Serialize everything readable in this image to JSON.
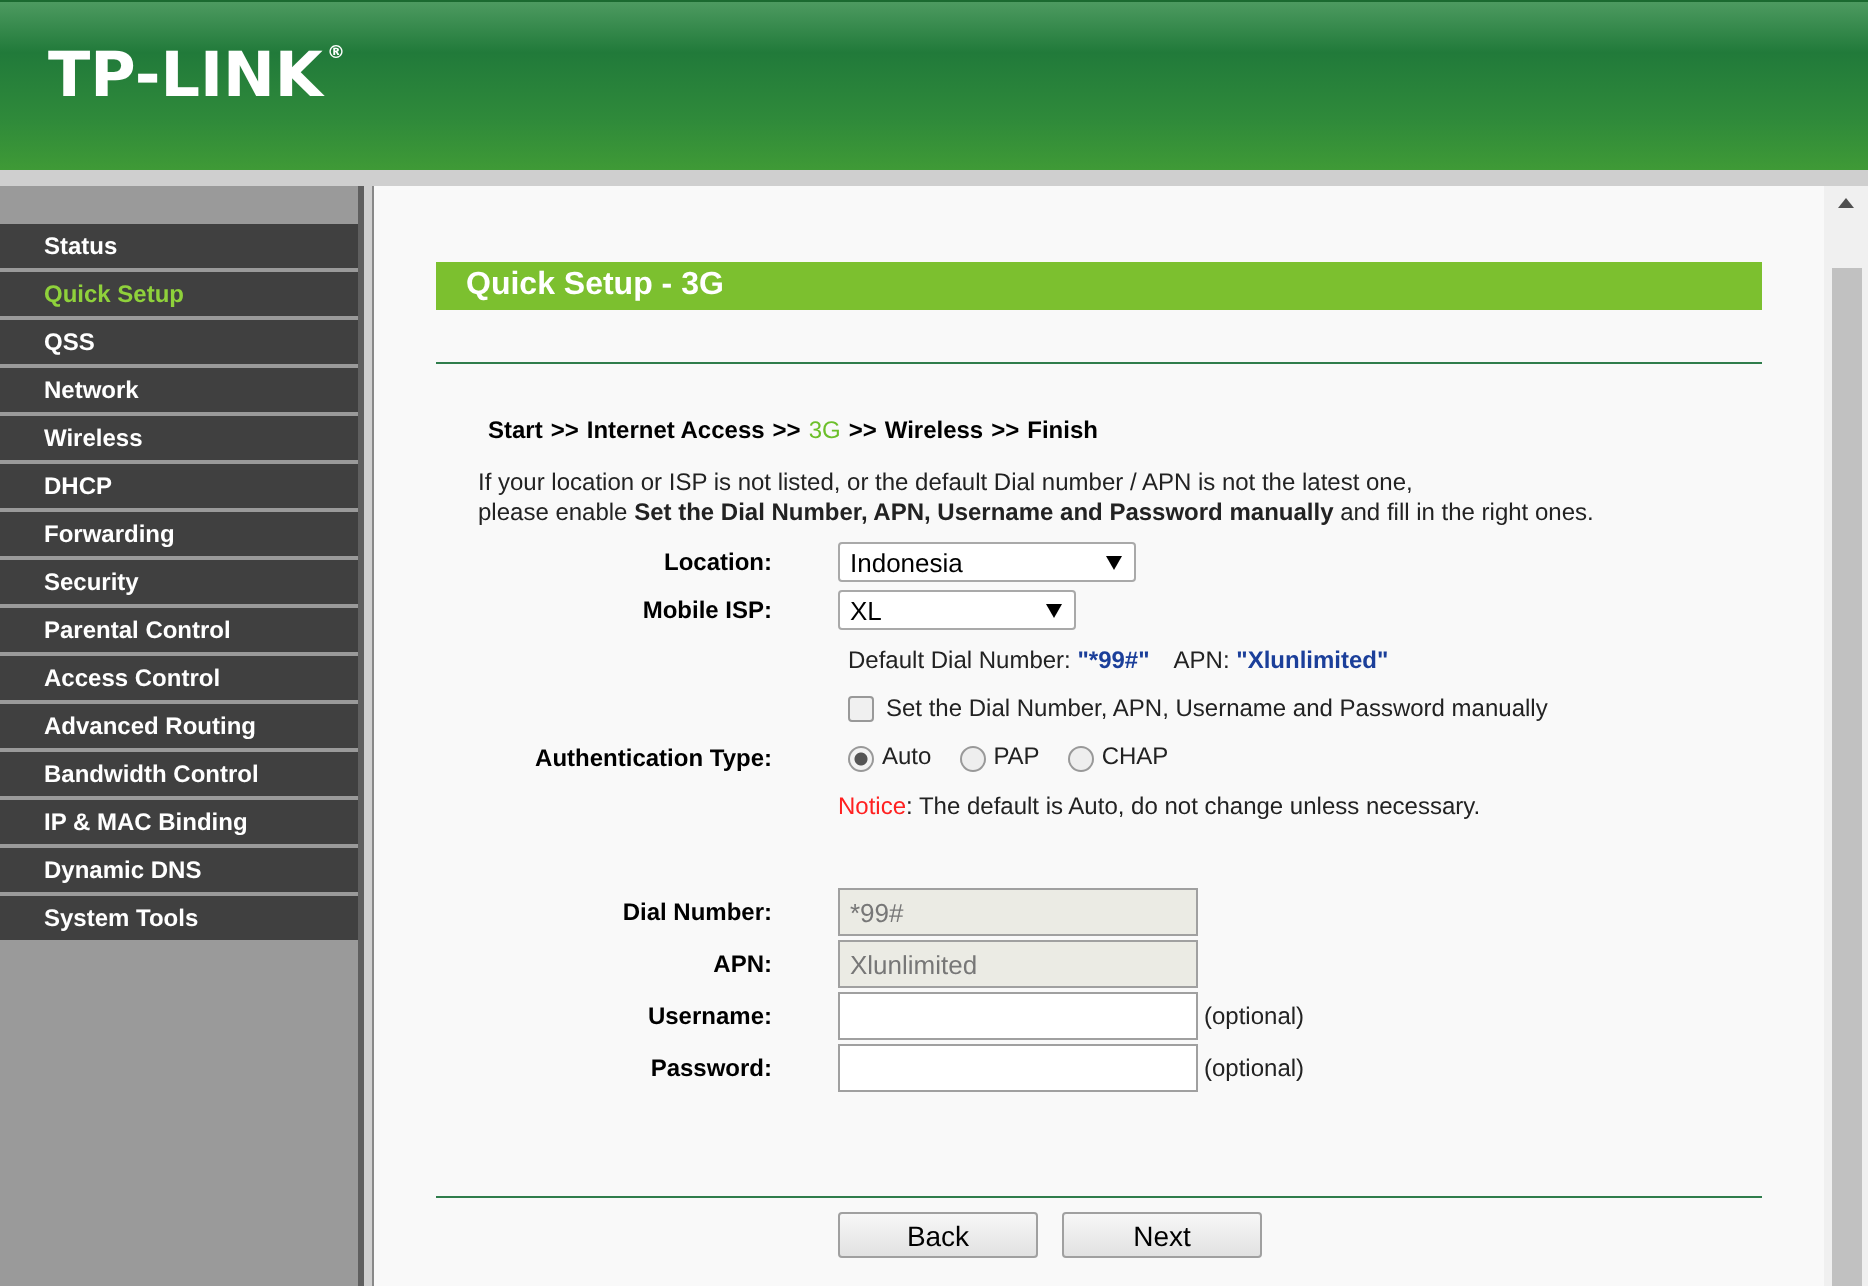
{
  "brand": {
    "logo": "TP-LINK",
    "mark": "®"
  },
  "sidebar": {
    "items": [
      {
        "label": "Status",
        "selected": false
      },
      {
        "label": "Quick Setup",
        "selected": true
      },
      {
        "label": "QSS",
        "selected": false
      },
      {
        "label": "Network",
        "selected": false
      },
      {
        "label": "Wireless",
        "selected": false
      },
      {
        "label": "DHCP",
        "selected": false
      },
      {
        "label": "Forwarding",
        "selected": false
      },
      {
        "label": "Security",
        "selected": false
      },
      {
        "label": "Parental Control",
        "selected": false
      },
      {
        "label": "Access Control",
        "selected": false
      },
      {
        "label": "Advanced Routing",
        "selected": false
      },
      {
        "label": "Bandwidth Control",
        "selected": false
      },
      {
        "label": "IP & MAC Binding",
        "selected": false
      },
      {
        "label": "Dynamic DNS",
        "selected": false
      },
      {
        "label": "System Tools",
        "selected": false
      }
    ]
  },
  "page_title": "Quick Setup - 3G",
  "breadcrumb": {
    "separator": ">>",
    "steps": [
      {
        "label": "Start",
        "selected": false
      },
      {
        "label": "Internet Access",
        "selected": false
      },
      {
        "label": "3G",
        "selected": true
      },
      {
        "label": "Wireless",
        "selected": false
      },
      {
        "label": "Finish",
        "selected": false
      }
    ]
  },
  "description": [
    "If your location or ISP is not listed, or the default Dial number / APN is not the latest one,",
    "please enable **Set the Dial Number, APN, Username and Password manually** and fill in the right ones."
  ],
  "location": {
    "label": "Location:",
    "value": "Indonesia"
  },
  "mobile_isp": {
    "label": "Mobile ISP:",
    "value": "XL"
  },
  "defaults": [
    {
      "label": "Default Dial Number:",
      "value": "\"*99#\""
    },
    {
      "label": "APN:",
      "value": "\"Xlunlimited\""
    }
  ],
  "manual": {
    "label": "Set the Dial Number, APN, Username and Password manually",
    "checked": false
  },
  "authentication": {
    "label": "Authentication Type:",
    "options": [
      {
        "label": "Auto",
        "selected": true
      },
      {
        "label": "PAP",
        "selected": false
      },
      {
        "label": "CHAP",
        "selected": false
      }
    ]
  },
  "notice": {
    "label": "Notice",
    "text": ": The default is Auto, do not change unless necessary."
  },
  "fields": [
    {
      "label": "Dial Number:",
      "value": "*99#",
      "disabled": true
    },
    {
      "label": "APN:",
      "value": "Xlunlimited",
      "disabled": true
    },
    {
      "label": "Username:",
      "disabled": false,
      "hint": "(optional)"
    },
    {
      "label": "Password:",
      "disabled": false,
      "hint": "(optional)"
    }
  ],
  "buttons": [
    "Back",
    "Next"
  ]
}
